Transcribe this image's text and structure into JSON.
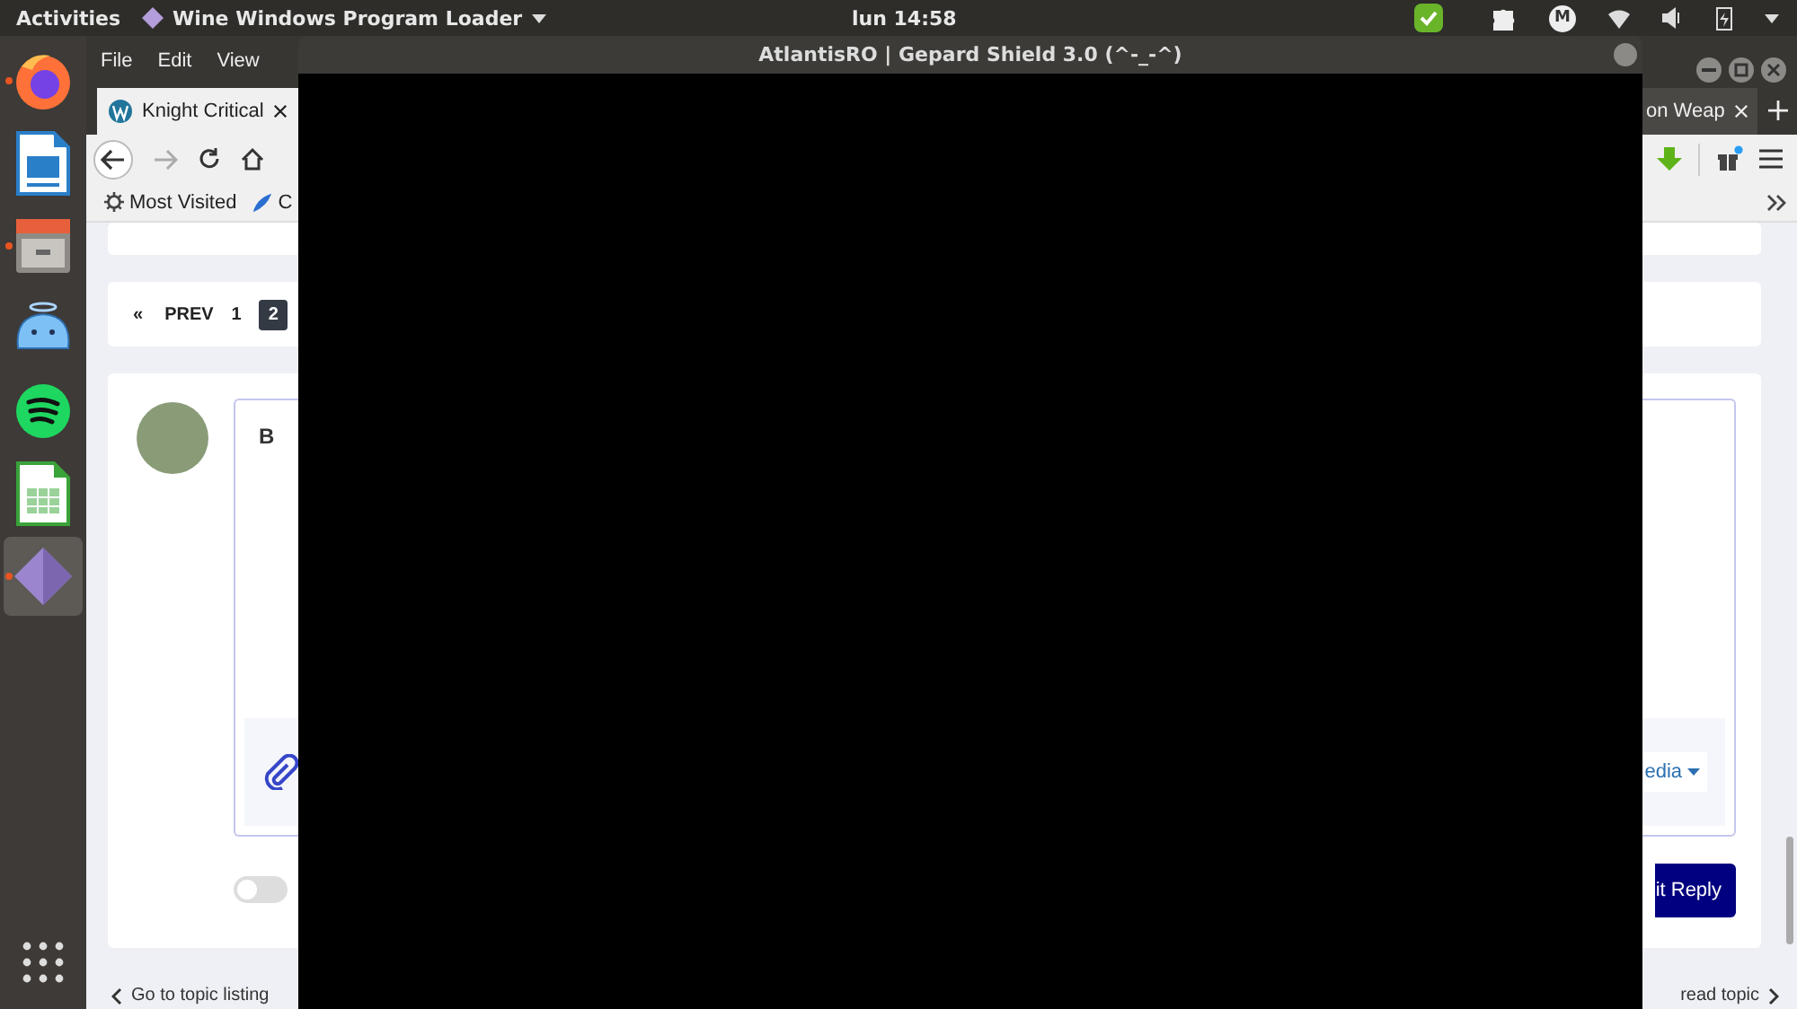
{
  "top_bar": {
    "activities": "Activities",
    "app_menu": "Wine Windows Program Loader",
    "clock": "lun 14:58",
    "tray_letter": "M"
  },
  "dock": {
    "items": [
      {
        "kind": "firefox",
        "running": true,
        "selected": false
      },
      {
        "kind": "writer",
        "running": false,
        "selected": false
      },
      {
        "kind": "files",
        "running": true,
        "selected": false
      },
      {
        "kind": "blob",
        "running": false,
        "selected": false
      },
      {
        "kind": "spotify",
        "running": false,
        "selected": false
      },
      {
        "kind": "calc",
        "running": false,
        "selected": false
      },
      {
        "kind": "wine",
        "running": true,
        "selected": true
      }
    ]
  },
  "browser": {
    "menu": [
      "File",
      "Edit",
      "View"
    ],
    "tabs": [
      {
        "label": "Knight Critical",
        "selected": true
      },
      {
        "label": "on Weap",
        "selected": false
      }
    ],
    "bookmarks": [
      {
        "label": "Most Visited",
        "kind": "folder"
      },
      {
        "label": "C",
        "kind": "link"
      }
    ],
    "pagination": {
      "first": "«",
      "prev": "PREV",
      "pages": [
        {
          "label": "1",
          "selected": false
        },
        {
          "label": "2",
          "selected": true
        }
      ]
    },
    "editor": {
      "bold": "B",
      "media_button": "edia",
      "toggle_on": false,
      "submit": "it Reply"
    },
    "footer": {
      "back_link": "Go to topic listing",
      "next_link": "read topic"
    }
  },
  "wine_window": {
    "title": "AtlantisRO | Gepard Shield 3.0 (^-_-^)"
  }
}
